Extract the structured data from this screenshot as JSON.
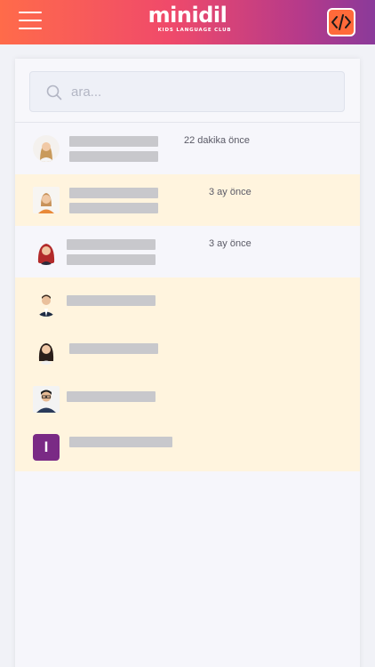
{
  "header": {
    "logo_main": "minidil",
    "logo_sub": "KIDS LANGUAGE CLUB",
    "gradient": [
      "#ff6b4a",
      "#8a3a9a"
    ]
  },
  "search": {
    "placeholder": "ara..."
  },
  "conversations": [
    {
      "time": "22 dakika önce",
      "avatar": "woman-blonde-avatar"
    },
    {
      "time": "3 ay önce",
      "avatar": "woman-orange-top-avatar"
    },
    {
      "time": "3 ay önce",
      "avatar": "woman-red-hair-avatar"
    },
    {
      "time": "",
      "avatar": "man-suit-avatar"
    },
    {
      "time": "",
      "avatar": "woman-dark-hair-avatar"
    },
    {
      "time": "",
      "avatar": "man-glasses-avatar"
    },
    {
      "time": "",
      "avatar": "letter-avatar",
      "letter": "I",
      "color": "#7a2a85"
    }
  ],
  "colors": {
    "highlight_row": "#fff4de",
    "placeholder_bar": "#c8c8cc"
  }
}
